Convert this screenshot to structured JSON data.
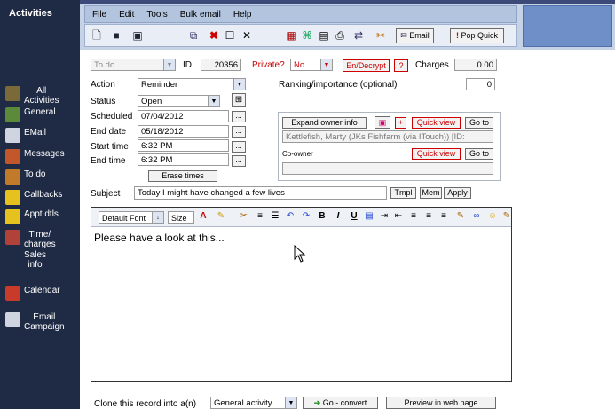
{
  "sidebar": {
    "title": "Activities",
    "items": [
      {
        "label": "All\nActivities",
        "icon": "list-icon",
        "color": "#7a6a3a"
      },
      {
        "label": "General",
        "icon": "document-icon",
        "color": "#5a8a3a"
      },
      {
        "label": "EMail",
        "icon": "email-icon",
        "color": "#cfd4e0"
      },
      {
        "label": "Messages",
        "icon": "messages-icon",
        "color": "#c2572c"
      },
      {
        "label": "To do",
        "icon": "todo-icon",
        "color": "#c07a2a"
      },
      {
        "label": "Callbacks",
        "icon": "callbacks-icon",
        "color": "#e6c21f"
      },
      {
        "label": "Appt dtls",
        "icon": "appointment-icon",
        "color": "#e6c21f"
      },
      {
        "label": "Time/\ncharges",
        "icon": "time-icon",
        "color": "#b0423a"
      },
      {
        "label": "Sales\ninfo",
        "icon": "dollar-icon",
        "color": "#1f2a44"
      },
      {
        "label": "Calendar",
        "icon": "calendar-icon",
        "color": "#c83a2a"
      },
      {
        "label": "Email\nCampaign",
        "icon": "campaign-icon",
        "color": "#cfd4e0"
      }
    ]
  },
  "menu": [
    "File",
    "Edit",
    "Tools",
    "Bulk email",
    "Help"
  ],
  "toolbar": {
    "email_label": "Email",
    "pop_quick_label": "Pop Quick"
  },
  "form": {
    "type_value": "To do",
    "id_label": "ID",
    "id_value": "20356",
    "private_label": "Private?",
    "private_value": "No",
    "endecrypt_label": "En/Decrypt",
    "help_label": "?",
    "charges_label": "Charges",
    "charges_value": "0.00",
    "action_label": "Action",
    "action_value": "Reminder",
    "status_label": "Status",
    "status_value": "Open",
    "ranking_label": "Ranking/importance (optional)",
    "ranking_value": "0",
    "scheduled_label": "Scheduled",
    "scheduled_value": "07/04/2012",
    "end_date_label": "End date",
    "end_date_value": "05/18/2012",
    "start_time_label": "Start time",
    "start_time_value": "6:32 PM",
    "end_time_label": "End time",
    "end_time_value": "6:32 PM",
    "ellipsis": "...",
    "erase_times_label": "Erase times",
    "subject_label": "Subject",
    "subject_value": "Today I might have changed a few lives",
    "tmpl_label": "Tmpl",
    "mem_label": "Mem",
    "apply_label": "Apply"
  },
  "owner": {
    "expand_label": "Expand owner info",
    "plus_label": "+",
    "quick_view_label": "Quick view",
    "go_to_label": "Go to",
    "owner_value": "Kettlefish, Marty (JKs Fishfarm (via ITouch)) [ID:",
    "coowner_label": "Co-owner",
    "coowner_value": ""
  },
  "editor": {
    "font_value": "Default Font",
    "size_value": "Size",
    "body_text": "Please have a look at this..."
  },
  "footer": {
    "clone_label": "Clone this record into a(n)",
    "clone_value": "General activity",
    "convert_label": "Go - convert",
    "preview_label": "Preview in web page"
  }
}
